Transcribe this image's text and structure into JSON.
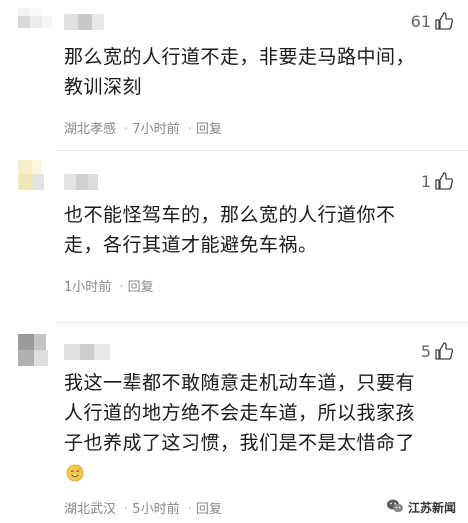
{
  "comments": [
    {
      "likes": "61",
      "lines": [
        "那么宽的人行道不走，非要走马路中间，",
        "教训深刻"
      ],
      "location": "湖北孝感",
      "time": "7小时前",
      "reply": "回复"
    },
    {
      "likes": "1",
      "lines": [
        "也不能怪驾车的，那么宽的人行道你不",
        "走，各行其道才能避免车祸。"
      ],
      "location": "",
      "time": "1小时前",
      "reply": "回复"
    },
    {
      "likes": "5",
      "lines": [
        "我这一辈都不敢随意走机动车道，只要有",
        "人行道的地方绝不会走车道，所以我家孩",
        "子也养成了这习惯，我们是不是太惜命了"
      ],
      "location": "湖北武汉",
      "time": "5小时前",
      "reply": "回复",
      "emoji": "sweat-smile-emoji"
    }
  ],
  "watermark": {
    "text": "江苏新闻",
    "icon": "wechat-icon"
  },
  "separator": "·",
  "colors": {
    "text": "#1a1a1a",
    "meta": "#888888",
    "divider": "#e6e6e6"
  }
}
